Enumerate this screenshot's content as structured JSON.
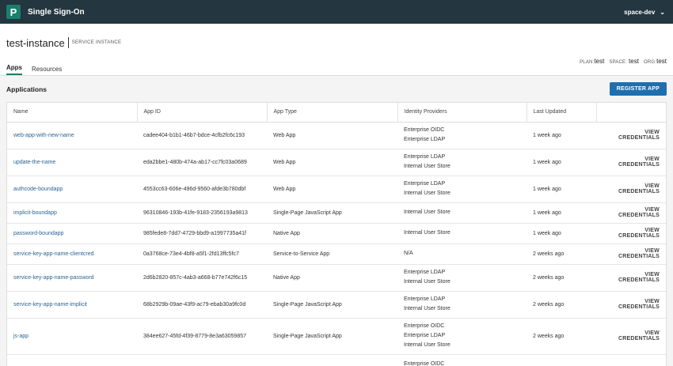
{
  "topbar": {
    "logo_letter": "P",
    "app_title": "Single Sign-On",
    "space_selector": "space-dev"
  },
  "header": {
    "instance_name": "test-instance",
    "instance_type": "SERVICE INSTANCE",
    "meta": [
      {
        "key": "PLAN:",
        "value": "test"
      },
      {
        "key": "SPACE:",
        "value": "test"
      },
      {
        "key": "ORG:",
        "value": "test"
      }
    ]
  },
  "tabs": [
    {
      "label": "Apps",
      "active": true
    },
    {
      "label": "Resources",
      "active": false
    }
  ],
  "section": {
    "title": "Applications",
    "register_button": "REGISTER APP"
  },
  "table": {
    "columns": [
      "Name",
      "App ID",
      "App Type",
      "Identity Providers",
      "Last Updated",
      ""
    ],
    "rows": [
      {
        "name": "web-app-with-new-name",
        "app_id": "cadee404-b1b1-46b7-bdce-4cfb2fc6c193",
        "app_type": "Web App",
        "idps": [
          "Enterprise OIDC",
          "Enterprise LDAP"
        ],
        "updated": "1 week ago",
        "action": "VIEW CREDENTIALS"
      },
      {
        "name": "update-the-name",
        "app_id": "eda2bbe1-480b-474a-ab17-cc7fc03a0689",
        "app_type": "Web App",
        "idps": [
          "Enterprise LDAP",
          "Internal User Store"
        ],
        "updated": "1 week ago",
        "action": "VIEW CREDENTIALS"
      },
      {
        "name": "authcode-boundapp",
        "app_id": "4553cc63-606e-496d-9560-afde3b780dbf",
        "app_type": "Web App",
        "idps": [
          "Enterprise LDAP",
          "Internal User Store"
        ],
        "updated": "1 week ago",
        "action": "VIEW CREDENTIALS"
      },
      {
        "name": "implicit-boundapp",
        "app_id": "96310846-193b-41fe-9183-2356193a9813",
        "app_type": "Single-Page JavaScript App",
        "idps": [
          "Internal User Store"
        ],
        "updated": "1 week ago",
        "action": "VIEW CREDENTIALS"
      },
      {
        "name": "password-boundapp",
        "app_id": "985fede8-7dd7-4729-bbd9-a1997735a41f",
        "app_type": "Native App",
        "idps": [
          "Internal User Store"
        ],
        "updated": "1 week ago",
        "action": "VIEW CREDENTIALS"
      },
      {
        "name": "service-key-app-name-clientcred",
        "app_id": "0a3768ce-73e4-4bf8-a5f1-2fd13ffc5fc7",
        "app_type": "Service-to-Service App",
        "idps": [
          "N/A"
        ],
        "updated": "2 weeks ago",
        "action": "VIEW CREDENTIALS"
      },
      {
        "name": "service-key-app-name-password",
        "app_id": "2d6b2820-857c-4ab3-a668-b77e742f6c15",
        "app_type": "Native App",
        "idps": [
          "Enterprise LDAP",
          "Internal User Store"
        ],
        "updated": "2 weeks ago",
        "action": "VIEW CREDENTIALS"
      },
      {
        "name": "service-key-app-name-implicit",
        "app_id": "68b2929b-09ae-43f9-ac79-ebab30a9fc0d",
        "app_type": "Single-Page JavaScript App",
        "idps": [
          "Enterprise LDAP",
          "Internal User Store"
        ],
        "updated": "2 weeks ago",
        "action": "VIEW CREDENTIALS"
      },
      {
        "name": "js-app",
        "app_id": "384ee627-45fd-4f39-8779-8e3a63059857",
        "app_type": "Single-Page JavaScript App",
        "idps": [
          "Enterprise OIDC",
          "Enterprise LDAP",
          "Internal User Store"
        ],
        "updated": "2 weeks ago",
        "action": "VIEW CREDENTIALS"
      },
      {
        "name": "",
        "app_id": "",
        "app_type": "",
        "idps": [
          "Enterprise OIDC"
        ],
        "updated": "",
        "action": ""
      }
    ]
  }
}
